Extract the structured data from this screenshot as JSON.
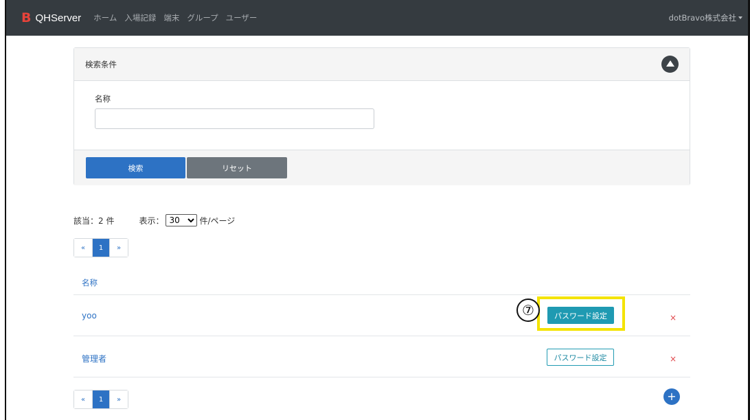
{
  "navbar": {
    "logo_letter": "B",
    "brand": "QHServer",
    "items": [
      "ホーム",
      "入場記録",
      "端末",
      "グループ",
      "ユーザー"
    ],
    "user": "dotBravo株式会社"
  },
  "search": {
    "title": "検索条件",
    "name_label": "名称",
    "name_value": "",
    "search_button": "検索",
    "reset_button": "リセット"
  },
  "results": {
    "count_text": "該当：2 件",
    "display_label": "表示：",
    "per_page": "30",
    "per_page_unit": "件/ページ"
  },
  "pagination": {
    "prev": "«",
    "current": "1",
    "next": "»"
  },
  "table": {
    "column_name": "名称",
    "rows": [
      {
        "name": "yoo",
        "password_button": "パスワード設定"
      },
      {
        "name": "管理者",
        "password_button": "パスワード設定"
      }
    ],
    "delete_glyph": "×",
    "add_glyph": "+"
  },
  "annotation": {
    "step": "⑦",
    "highlight_color": "#f4e300"
  },
  "colors": {
    "navbar_bg": "#353b40",
    "primary": "#2d72c4",
    "secondary": "#6d757c",
    "info": "#1f9ab2",
    "danger": "#e0454a",
    "logo": "#e8433a"
  }
}
